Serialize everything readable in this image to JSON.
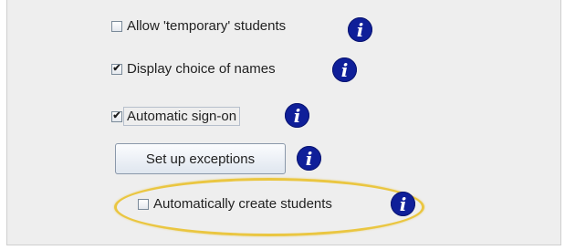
{
  "options": {
    "allow_temporary": {
      "label": "Allow 'temporary' students",
      "checked": false
    },
    "display_choice": {
      "label": "Display choice of names",
      "checked": true
    },
    "automatic_signon": {
      "label": "Automatic sign-on",
      "checked": true
    },
    "setup_exceptions": {
      "label": "Set up exceptions"
    },
    "auto_create": {
      "label": "Automatically create students",
      "checked": false
    }
  },
  "icons": {
    "info": "info-icon",
    "info_glyph": "i"
  },
  "colors": {
    "info": "#0f1f99",
    "highlight_ring": "#eac641",
    "panel": "#eeeeee"
  }
}
